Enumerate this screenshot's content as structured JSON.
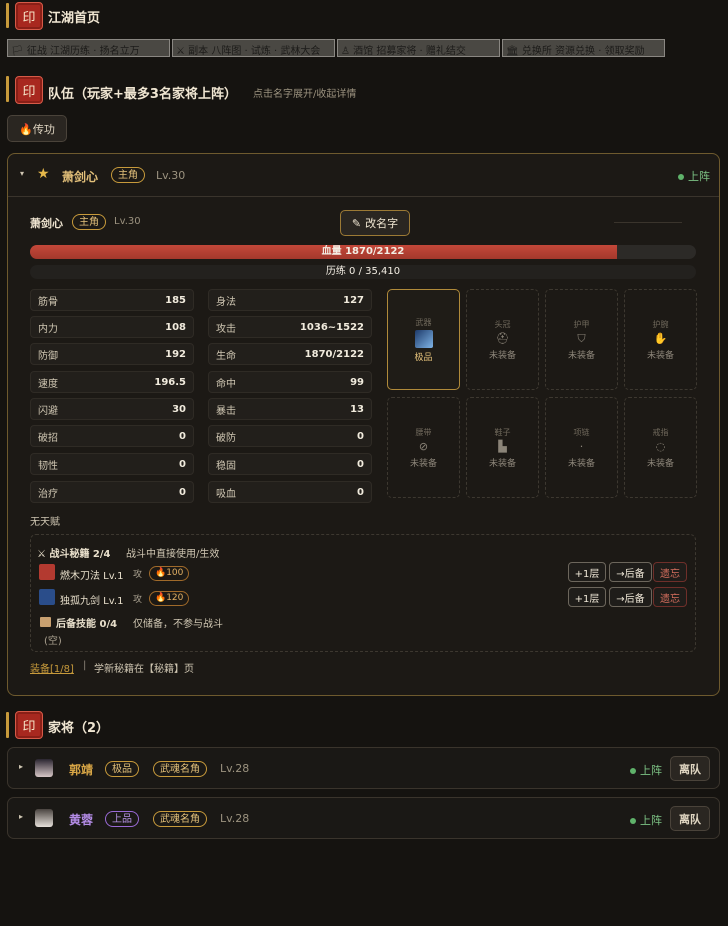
{
  "header": {
    "seal": "印",
    "title": "江湖首页"
  },
  "nav": [
    "🏳 征战 江湖历练 · 扬名立万",
    "⚔ 副本 八阵图 · 试炼 · 武林大会",
    "♙ 酒馆 招募家将 · 赠礼结交",
    "🏛 兑换所 资源兑换 · 领取奖励"
  ],
  "team": {
    "seal": "印",
    "title": "队伍（玩家+最多3名家将上阵）",
    "hint": "点击名字展开/收起详情",
    "transfer_btn": "🔥传功"
  },
  "leader": {
    "caret": "▾",
    "star": "★",
    "name": "萧剑心",
    "role_tag": "主角",
    "level": "Lv.30",
    "status": "上阵",
    "rename_btn": "改名字",
    "hp_text": "血量 1870/2122",
    "hp_ratio": 0.881,
    "exp_text": "历练 0 / 35,410",
    "exp_ratio": 0,
    "stats_left": [
      {
        "k": "筋骨",
        "v": "185"
      },
      {
        "k": "内力",
        "v": "108"
      },
      {
        "k": "防御",
        "v": "192"
      },
      {
        "k": "速度",
        "v": "196.5"
      },
      {
        "k": "闪避",
        "v": "30"
      },
      {
        "k": "破招",
        "v": "0"
      },
      {
        "k": "韧性",
        "v": "0"
      },
      {
        "k": "治疗",
        "v": "0"
      }
    ],
    "stats_right": [
      {
        "k": "身法",
        "v": "127"
      },
      {
        "k": "攻击",
        "v": "1036~1522"
      },
      {
        "k": "生命",
        "v": "1870/2122"
      },
      {
        "k": "命中",
        "v": "99"
      },
      {
        "k": "暴击",
        "v": "13"
      },
      {
        "k": "破防",
        "v": "0"
      },
      {
        "k": "稳固",
        "v": "0"
      },
      {
        "k": "吸血",
        "v": "0"
      }
    ],
    "equipment": [
      {
        "slot": "武器",
        "status": "极品",
        "icon": "sword-icon"
      },
      {
        "slot": "头冠",
        "status": "未装备",
        "icon": "helmet-icon"
      },
      {
        "slot": "护甲",
        "status": "未装备",
        "icon": "shield-icon"
      },
      {
        "slot": "护腕",
        "status": "未装备",
        "icon": "glove-icon"
      },
      {
        "slot": "腰带",
        "status": "未装备",
        "icon": "belt-icon"
      },
      {
        "slot": "鞋子",
        "status": "未装备",
        "icon": "boot-icon"
      },
      {
        "slot": "项链",
        "status": "未装备",
        "icon": "necklace-icon"
      },
      {
        "slot": "戒指",
        "status": "未装备",
        "icon": "ring-icon"
      }
    ],
    "talent": "无天赋",
    "skills": {
      "combat_title": "⚔ 战斗秘籍 2/4",
      "combat_desc": "战斗中直接使用/生效",
      "list": [
        {
          "name": "燃木刀法 Lv.1",
          "type": "攻",
          "cost": "🔥100"
        },
        {
          "name": "独孤九剑 Lv.1",
          "type": "攻",
          "cost": "🔥120"
        }
      ],
      "btn_up": "+1层",
      "btn_back": "→后备",
      "btn_forget": "遗忘",
      "reserve_title": "后备技能 0/4",
      "reserve_desc": "仅储备，不参与战斗",
      "reserve_empty": "(空)"
    },
    "footer_link": "装备[1/8]",
    "footer_sep": "|",
    "footer_text": "学新秘籍在【秘籍】页"
  },
  "generals": {
    "seal": "印",
    "title": "家将（2）",
    "list": [
      {
        "caret": "▸",
        "name": "郭靖",
        "grade": "极品",
        "tag": "武魂名角",
        "level": "Lv.28",
        "status": "上阵",
        "leave_btn": "离队"
      },
      {
        "caret": "▸",
        "name": "黄蓉",
        "grade": "上品",
        "tag": "武魂名角",
        "level": "Lv.28",
        "status": "上阵",
        "leave_btn": "离队"
      }
    ]
  },
  "colors": {
    "accent": "#c79a3b",
    "hp": "#c4483a",
    "seal": "#a8281f",
    "green": "#5fb26a",
    "purple": "#9a6ad6"
  }
}
